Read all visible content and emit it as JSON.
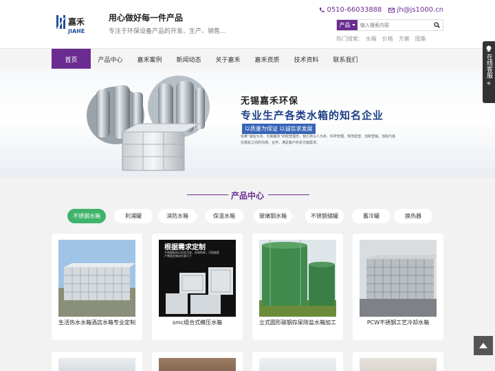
{
  "header": {
    "slogan": "用心做好每一件产品",
    "subslogan": "专注于环保设备产品的开发、生产、销售...",
    "phone": "0510-66033888",
    "email": "jh@js1000.cn",
    "logo_text": "嘉禾 JIAHE"
  },
  "search": {
    "category": "产品",
    "placeholder": "输入搜索内容",
    "hot_label": "热门搜索:",
    "hot_terms": [
      "水箱",
      "价格",
      "方案",
      "图集"
    ]
  },
  "nav": {
    "items": [
      "首页",
      "产品中心",
      "嘉禾案例",
      "新闻动态",
      "关于嘉禾",
      "嘉禾资质",
      "技术资料",
      "联系我们"
    ]
  },
  "banner": {
    "company": "无锡嘉禾环保",
    "headline": "专业生产各类水箱的知名企业",
    "tagline": "以质量为保证 以诚信求发展",
    "description": "信奉“诚信为本、长期服务”的经营理念，我们将以人为本、科学管理、规范经营、创新营销、加强与各位朋友之间的沟通、合作，满足客户的多方面需求。"
  },
  "products": {
    "title": "产品中心",
    "tabs": [
      "不锈钢水箱",
      "利浦罐",
      "消防水箱",
      "保温水箱",
      "玻璃钢水箱",
      "不锈钢储罐",
      "蓄冷罐",
      "换热器"
    ],
    "active_tab": "不锈钢水箱",
    "items": [
      {
        "caption": "生活热水水箱酒店水箱专业定制"
      },
      {
        "caption": "smc组合式模压水箱",
        "image_text": "根据需求定制",
        "image_subtext": "不锈钢板材以实际为准，安装简单，可根据客户需要定做成任意尺寸"
      },
      {
        "caption": "立式圆形碳钢存尿除盐水箱加工"
      },
      {
        "caption": "PCW不锈钢工艺冷却水箱"
      }
    ]
  },
  "side": {
    "service_label": "在线客服",
    "arrow": "«"
  },
  "colors": {
    "brand": "#6b2c91",
    "active_tab": "#3fb36a",
    "banner_blue": "#1c3f86"
  }
}
